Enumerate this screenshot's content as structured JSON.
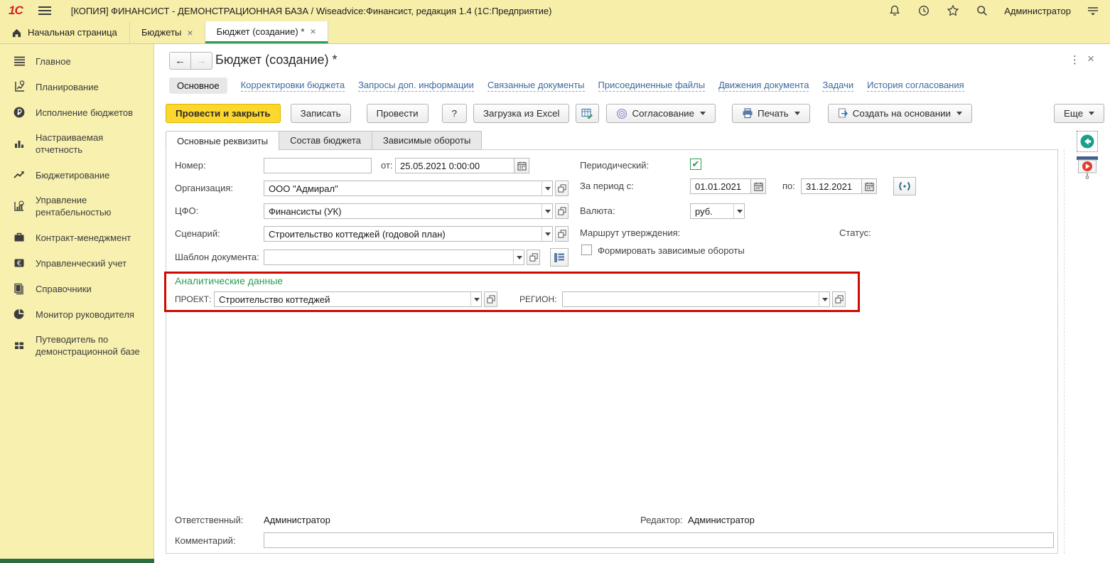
{
  "colors": {
    "bar_yellow": "#f6eea9",
    "primary_button_yellow": "#fdd72c",
    "active_tab_green": "#2e9e52",
    "link_blue": "#3e6a9e",
    "annotation_red": "#cf0a00",
    "analytics_green": "#2e9e52"
  },
  "titlebar": {
    "app_title": "[КОПИЯ] ФИНАНСИСТ - ДЕМОНСТРАЦИОННАЯ БАЗА / Wiseadvice:Финансист, редакция 1.4  (1С:Предприятие)",
    "user": "Администратор"
  },
  "tabs": [
    {
      "label": "Начальная страница"
    },
    {
      "label": "Бюджеты",
      "close": "×"
    },
    {
      "label": "Бюджет (создание) *",
      "close": "×"
    }
  ],
  "sidebar": {
    "items": [
      {
        "label": "Главное"
      },
      {
        "label": "Планирование"
      },
      {
        "label": "Исполнение бюджетов"
      },
      {
        "label": "Настраиваемая отчетность"
      },
      {
        "label": "Бюджетирование"
      },
      {
        "label": "Управление рентабельностью"
      },
      {
        "label": "Контракт-менеджмент"
      },
      {
        "label": "Управленческий учет"
      },
      {
        "label": "Справочники"
      },
      {
        "label": "Монитор руководителя"
      },
      {
        "label": "Путеводитель по демонстрационной базе"
      }
    ]
  },
  "document": {
    "title": "Бюджет (создание) *",
    "nav_links": [
      "Основное",
      "Корректировки бюджета",
      "Запросы доп. информации",
      "Связанные документы",
      "Присоединенные файлы",
      "Движения документа",
      "Задачи",
      "История согласования"
    ],
    "toolbar": {
      "post_close": "Провести и закрыть",
      "save": "Записать",
      "post": "Провести",
      "help": "?",
      "excel": "Загрузка из Excel",
      "approval": "Согласование",
      "print": "Печать",
      "create_based": "Создать на основании",
      "more": "Еще"
    },
    "form_tabs": [
      "Основные реквизиты",
      "Состав бюджета",
      "Зависимые обороты"
    ],
    "fields": {
      "number_label": "Номер:",
      "number_value": "",
      "date_label": "от:",
      "date_value": "25.05.2021 0:00:00",
      "org_label": "Организация:",
      "org_value": "ООО \"Адмирал\"",
      "cfo_label": "ЦФО:",
      "cfo_value": "Финансисты (УК)",
      "scenario_label": "Сценарий:",
      "scenario_value": "Строительство коттеджей (годовой план)",
      "template_label": "Шаблон документа:",
      "template_value": "",
      "periodic_label": "Периодический:",
      "periodic_check": "✔",
      "period_from_label": "За период с:",
      "period_from_value": "01.01.2021",
      "period_to_label": "по:",
      "period_to_value": "31.12.2021",
      "currency_label": "Валюта:",
      "currency_value": "руб.",
      "route_label": "Маршрут утверждения:",
      "status_label": "Статус:",
      "dependent_label": "Формировать зависимые обороты"
    },
    "analytics": {
      "title": "Аналитические данные",
      "project_label": "ПРОЕКТ:",
      "project_value": "Строительство коттеджей",
      "region_label": "РЕГИОН:",
      "region_value": ""
    },
    "footer": {
      "responsible_label": "Ответственный:",
      "responsible_value": "Администратор",
      "editor_label": "Редактор:",
      "editor_value": "Администратор",
      "comment_label": "Комментарий:",
      "comment_value": ""
    }
  }
}
